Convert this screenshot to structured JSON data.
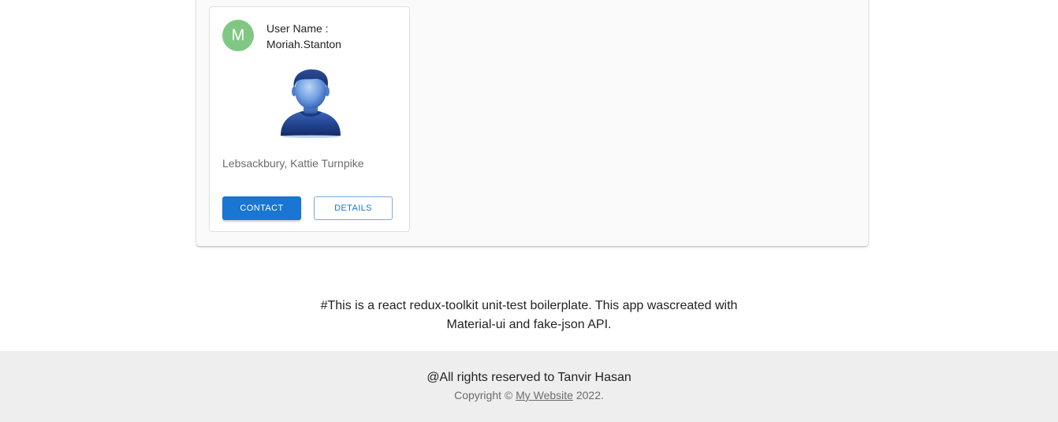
{
  "card": {
    "avatar_letter": "M",
    "avatar_color": "#81c784",
    "user_name_label": "User Name :",
    "user_name_value": "Moriah.Stanton",
    "photo_icon": "user-silhouette-icon",
    "address": "Lebsackbury, Kattie Turnpike",
    "contact_label": "CONTACT",
    "details_label": "DETAILS",
    "primary_color": "#1976d2"
  },
  "description": {
    "line1": "#This is a react redux-toolkit unit-test boilerplate. This app wascreated with",
    "line2": "Material-ui and fake-json API."
  },
  "footer": {
    "rights": "@All rights reserved to Tanvir Hasan",
    "copyright_prefix": "Copyright ©",
    "link_text": "My Website",
    "year_suffix": "2022."
  }
}
